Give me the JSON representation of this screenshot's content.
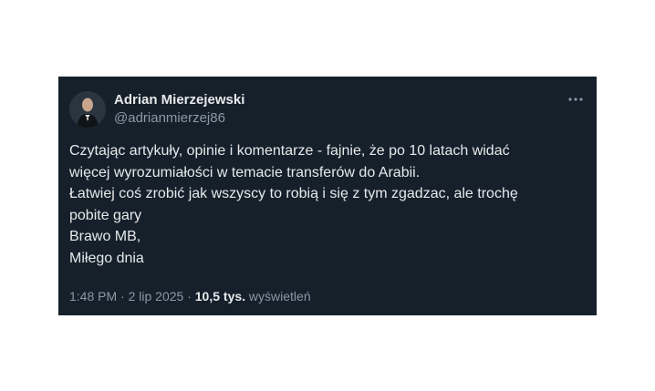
{
  "author": {
    "display_name": "Adrian Mierzejewski",
    "handle": "@adrianmierzej86",
    "avatar_icon": "profile-photo-avatar"
  },
  "more_icon": "more-dots-icon",
  "tweet": {
    "lines": [
      "Czytając artykuły, opinie i komentarze - fajnie, że po 10 latach widać",
      "więcej wyrozumiałości w temacie transferów do Arabii.",
      "Łatwiej coś zrobić jak wszyscy to robią i się z tym zgadzac, ale trochę",
      "pobite gary",
      "Brawo MB,",
      "Miłego dnia"
    ]
  },
  "meta": {
    "time": "1:48 PM",
    "separator": " · ",
    "date": "2 lip 2025",
    "views_count": "10,5 tys.",
    "views_label": "wyświetleń"
  },
  "colors": {
    "card_background": "#15202b",
    "primary_text": "#e7e9ea",
    "secondary_text": "#8b98a5"
  }
}
